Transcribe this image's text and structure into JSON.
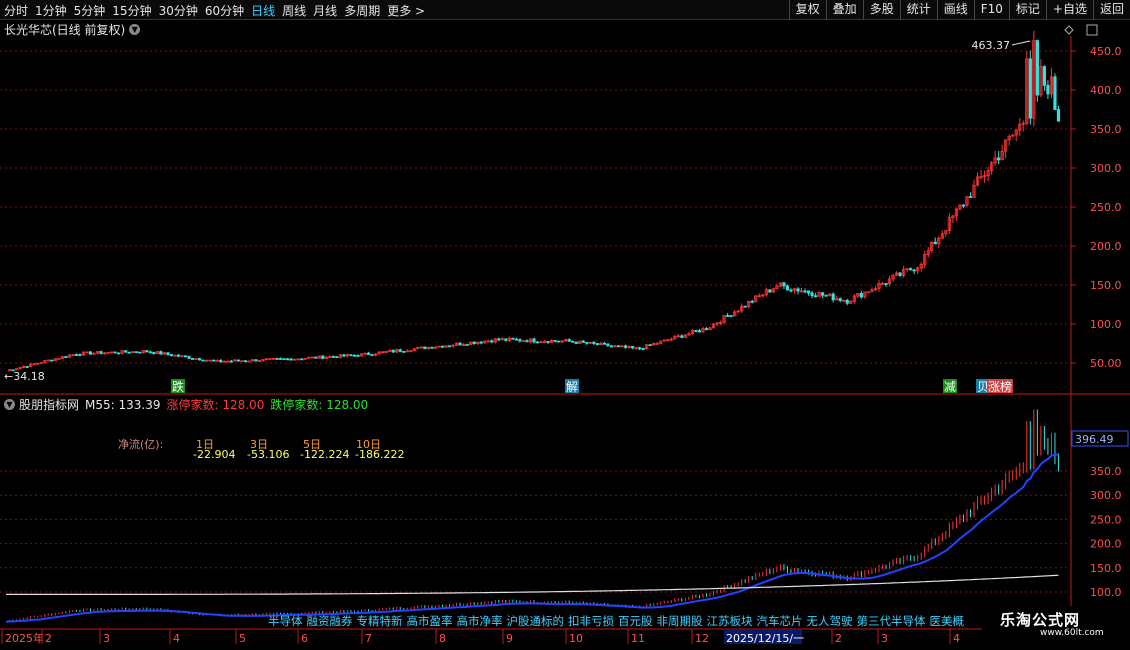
{
  "toolbar": {
    "periods": [
      "分时",
      "1分钟",
      "5分钟",
      "15分钟",
      "30分钟",
      "60分钟",
      "日线",
      "周线",
      "月线",
      "多周期",
      "更多 >"
    ],
    "active_period": "日线",
    "actions": [
      "复权",
      "叠加",
      "多股",
      "统计",
      "画线",
      "F10",
      "标记",
      "+自选",
      "返回"
    ]
  },
  "main_chart": {
    "title": "长光华芯(日线 前复权)",
    "high_label": "463.37",
    "low_label": "←34.18",
    "y_ticks": [
      "450.0",
      "400.0",
      "350.0",
      "300.0",
      "250.0",
      "200.0",
      "150.0",
      "100.0",
      "50.00"
    ],
    "event_markers": [
      {
        "text": "跌",
        "color": "#1c8c1c"
      },
      {
        "text": "解",
        "color": "#1c7ca8"
      },
      {
        "text": "减",
        "color": "#1c8c1c"
      },
      {
        "text": "贝",
        "color": "#1c7ca8"
      },
      {
        "text": "涨榜",
        "color": "#d04040"
      }
    ]
  },
  "indicator": {
    "name": "股朋指标网",
    "m55": "M55: 133.39",
    "limit_up": "涨停家数: 128.00",
    "limit_down": "跌停家数: 128.00",
    "net_flow_label": "净流(亿):",
    "periods": [
      "1日",
      "3日",
      "5日",
      "10日"
    ],
    "values": [
      "-22.904",
      "-53.106",
      "-122.224",
      "-186.222"
    ],
    "y_ticks": [
      "350.0",
      "300.0",
      "250.0",
      "200.0",
      "150.0",
      "100.0"
    ],
    "current_value": "396.49",
    "sectors": [
      "半导体",
      "融资融券",
      "专精特新",
      "高市盈率",
      "高市净率",
      "沪股通标的",
      "扣非亏损",
      "百元股",
      "非周期股",
      "江苏板块",
      "汽车芯片",
      "无人驾驶",
      "第三代半导体",
      "医美概"
    ]
  },
  "time_axis": {
    "labels": [
      "2025年",
      "2",
      "3",
      "4",
      "5",
      "6",
      "7",
      "8",
      "9",
      "10",
      "11",
      "12",
      "2025/12/15/一",
      "2",
      "3",
      "4"
    ]
  },
  "chart_data": {
    "type": "line",
    "title": "长光华芯(日线 前复权)",
    "x": [
      "2025-01",
      "2025-02",
      "2025-03",
      "2025-04",
      "2025-05",
      "2025-06",
      "2025-07",
      "2025-08",
      "2025-09",
      "2025-10",
      "2025-11",
      "2025-12",
      "2026-01",
      "2026-02",
      "2026-03",
      "2026-04"
    ],
    "series": [
      {
        "values": [
          40,
          62,
          65,
          52,
          55,
          60,
          70,
          80,
          78,
          68,
          95,
          150,
          130,
          175,
          300,
          420
        ]
      }
    ],
    "ylim": [
      20,
      470
    ]
  },
  "logo": {
    "name": "乐淘公式网",
    "url": "www.60lt.com"
  },
  "colors": {
    "up": "#ff3333",
    "down": "#33e0e0",
    "grid": "#7a1414",
    "axis": "#c01818",
    "blue_line": "#2244ff"
  }
}
